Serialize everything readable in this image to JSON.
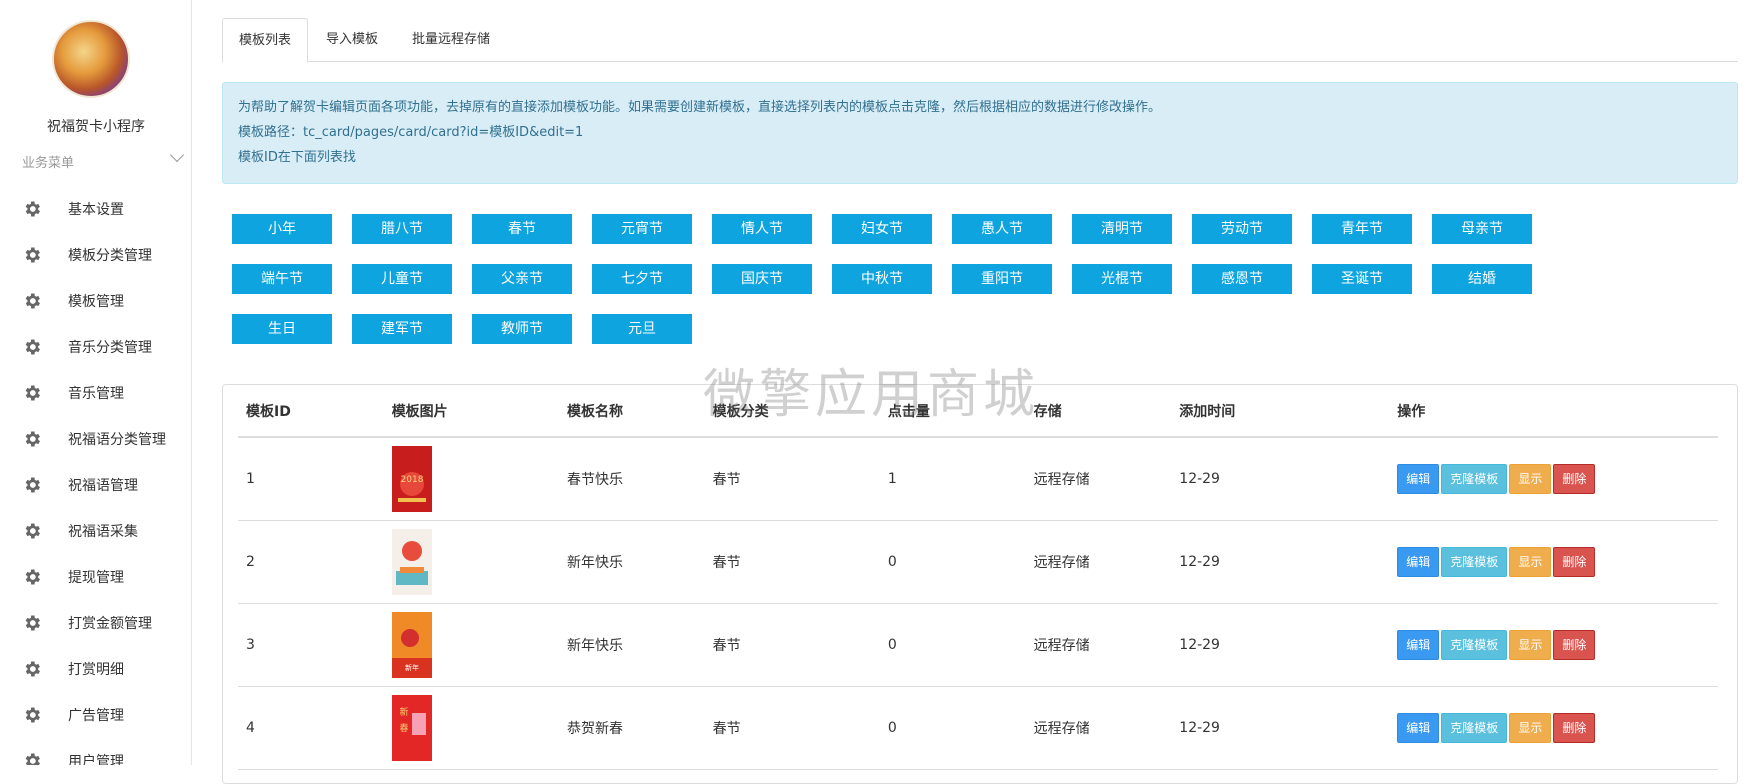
{
  "sidebar": {
    "app_name": "祝福贺卡小程序",
    "menu_header": "业务菜单",
    "items": [
      {
        "label": "基本设置",
        "icon": "gear-icon"
      },
      {
        "label": "模板分类管理",
        "icon": "gear-icon"
      },
      {
        "label": "模板管理",
        "icon": "gear-icon"
      },
      {
        "label": "音乐分类管理",
        "icon": "gear-icon"
      },
      {
        "label": "音乐管理",
        "icon": "gear-icon"
      },
      {
        "label": "祝福语分类管理",
        "icon": "gear-icon"
      },
      {
        "label": "祝福语管理",
        "icon": "gear-icon"
      },
      {
        "label": "祝福语采集",
        "icon": "gear-icon"
      },
      {
        "label": "提现管理",
        "icon": "gear-icon"
      },
      {
        "label": "打赏金额管理",
        "icon": "gear-icon"
      },
      {
        "label": "打赏明细",
        "icon": "gear-icon"
      },
      {
        "label": "广告管理",
        "icon": "gear-icon"
      },
      {
        "label": "用户管理",
        "icon": "gear-icon"
      }
    ]
  },
  "tabs": [
    "模板列表",
    "导入模板",
    "批量远程存储"
  ],
  "notice": {
    "line1": "为帮助了解贺卡编辑页面各项功能，去掉原有的直接添加模板功能。如果需要创建新模板，直接选择列表内的模板点击克隆，然后根据相应的数据进行修改操作。",
    "line2": "模板路径：tc_card/pages/card/card?id=模板ID&edit=1",
    "line3": "模板ID在下面列表找"
  },
  "categories": [
    "小年",
    "腊八节",
    "春节",
    "元宵节",
    "情人节",
    "妇女节",
    "愚人节",
    "清明节",
    "劳动节",
    "青年节",
    "母亲节",
    "端午节",
    "儿童节",
    "父亲节",
    "七夕节",
    "国庆节",
    "中秋节",
    "重阳节",
    "光棍节",
    "感恩节",
    "圣诞节",
    "结婚",
    "生日",
    "建军节",
    "教师节",
    "元旦"
  ],
  "watermark": "微擎应用商城",
  "table": {
    "headers": [
      "模板ID",
      "模板图片",
      "模板名称",
      "模板分类",
      "点击量",
      "存储",
      "添加时间",
      "操作"
    ],
    "rows": [
      {
        "id": "1",
        "name": "春节快乐",
        "category": "春节",
        "clicks": "1",
        "storage": "远程存储",
        "time": "12-29"
      },
      {
        "id": "2",
        "name": "新年快乐",
        "category": "春节",
        "clicks": "0",
        "storage": "远程存储",
        "time": "12-29"
      },
      {
        "id": "3",
        "name": "新年快乐",
        "category": "春节",
        "clicks": "0",
        "storage": "远程存储",
        "time": "12-29"
      },
      {
        "id": "4",
        "name": "恭贺新春",
        "category": "春节",
        "clicks": "0",
        "storage": "远程存储",
        "time": "12-29"
      }
    ],
    "actions": {
      "edit": "编辑",
      "clone": "克隆模板",
      "show": "显示",
      "delete": "删除"
    }
  },
  "colors": {
    "category_button": "#0ea4e0",
    "edit": "#3a99f1",
    "clone": "#5bc0de",
    "show": "#f0ad4e",
    "delete": "#d9534f"
  }
}
